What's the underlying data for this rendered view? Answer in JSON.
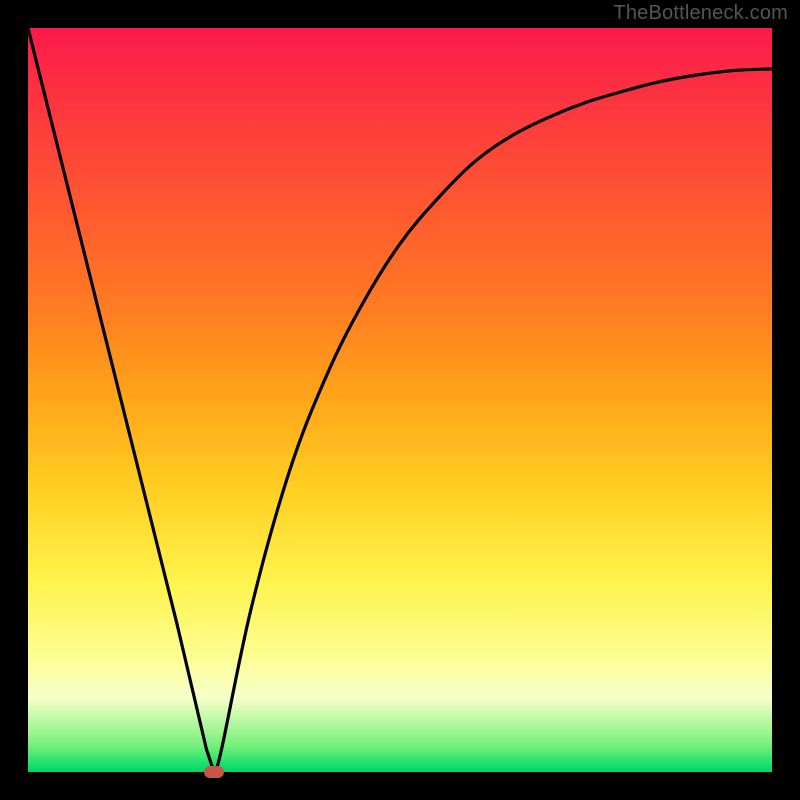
{
  "watermark": "TheBottleneck.com",
  "chart_data": {
    "type": "line",
    "title": "",
    "xlabel": "",
    "ylabel": "",
    "xlim": [
      0,
      100
    ],
    "ylim": [
      0,
      100
    ],
    "grid": false,
    "legend": false,
    "series": [
      {
        "name": "curve",
        "x": [
          0,
          5,
          10,
          15,
          20,
          24,
          25,
          26,
          30,
          35,
          40,
          45,
          50,
          55,
          60,
          65,
          70,
          75,
          80,
          85,
          90,
          95,
          100
        ],
        "values": [
          100,
          80,
          60,
          40,
          20,
          3,
          0,
          3,
          22,
          40,
          53,
          63,
          71,
          77,
          82,
          85.5,
          88,
          90,
          91.5,
          92.8,
          93.7,
          94.3,
          94.5
        ]
      }
    ],
    "marker": {
      "x": 25,
      "y": 0,
      "color": "#c6564a"
    },
    "gradient_stops": [
      {
        "pos": 0,
        "color": "#fb1a4b"
      },
      {
        "pos": 0.25,
        "color": "#ff5a2f"
      },
      {
        "pos": 0.5,
        "color": "#ffa619"
      },
      {
        "pos": 0.74,
        "color": "#fff24a"
      },
      {
        "pos": 0.9,
        "color": "#f8ffc9"
      },
      {
        "pos": 1.0,
        "color": "#00d56a"
      }
    ]
  }
}
